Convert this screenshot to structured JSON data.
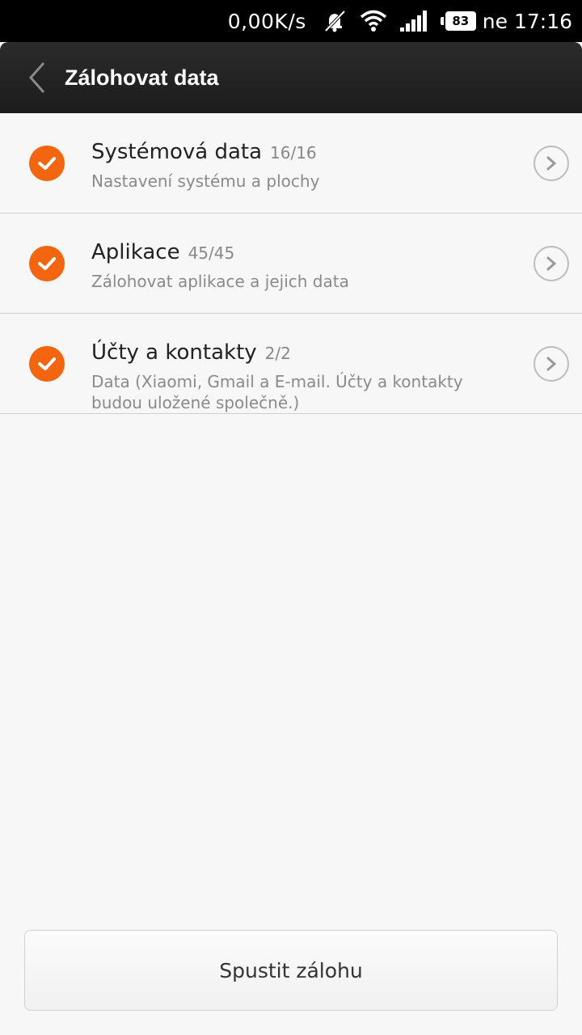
{
  "status_bar": {
    "network_speed": "0,00K/s",
    "battery_level": "83",
    "day_time": "ne 17:16",
    "icons": [
      "notifications-muted-icon",
      "wifi-icon",
      "signal-icon",
      "battery-icon"
    ]
  },
  "header": {
    "title": "Zálohovat data",
    "back_icon": "chevron-left-icon"
  },
  "items": [
    {
      "title": "Systémová data",
      "count": "16/16",
      "subtitle": "Nastavení systému a plochy",
      "checked": true
    },
    {
      "title": "Aplikace",
      "count": "45/45",
      "subtitle": "Zálohovat aplikace a jejich data",
      "checked": true
    },
    {
      "title": "Účty a kontakty",
      "count": "2/2",
      "subtitle": "Data (Xiaomi, Gmail a E-mail. Účty a kontakty budou uložené společně.)",
      "checked": true
    }
  ],
  "footer": {
    "start_label": "Spustit zálohu"
  },
  "colors": {
    "accent": "#f4650f",
    "header_bg": "#222222",
    "background": "#f7f7f7"
  }
}
